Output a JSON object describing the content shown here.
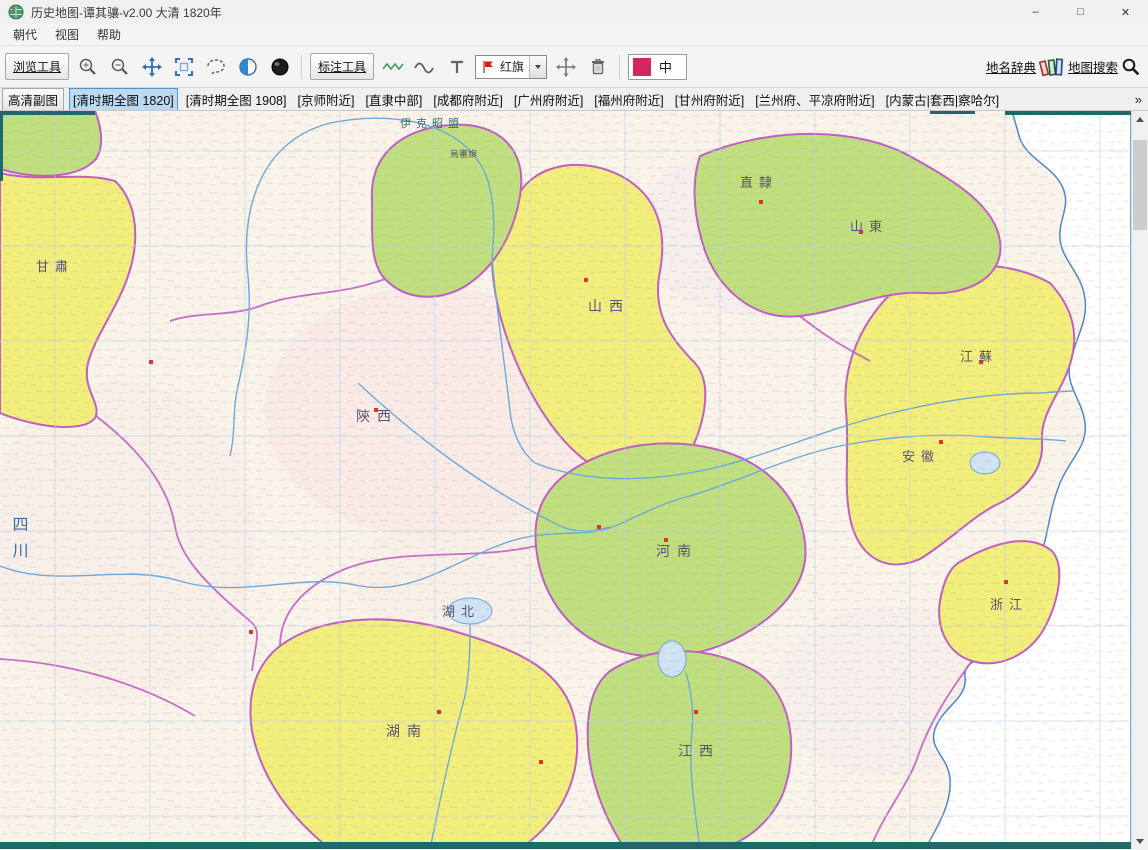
{
  "window": {
    "title": "历史地图-谭其骧-v2.00  大清 1820年",
    "controls": {
      "minimize": "–",
      "maximize": "□",
      "close": "✕"
    }
  },
  "menu": {
    "items": [
      {
        "label": "朝代"
      },
      {
        "label": "视图"
      },
      {
        "label": "帮助"
      }
    ]
  },
  "toolbar": {
    "browse_tools_label": "浏览工具",
    "annotate_tools_label": "标注工具",
    "flag_selector_value": "红旗",
    "marker_text": "中",
    "dictionary_label": "地名辞典",
    "map_search_label": "地图搜索",
    "icons": [
      "zoom-in",
      "zoom-out",
      "pan",
      "fit-view",
      "lasso-select",
      "contrast-sphere",
      "dark-sphere",
      "wave-line",
      "curve-line",
      "text-tool",
      "red-flag",
      "move",
      "trash",
      "books",
      "search"
    ],
    "marker_swatch_color": "#d42663"
  },
  "tabs": {
    "items": [
      {
        "label": "高清副图",
        "selected": false
      },
      {
        "label": "[清时期全图 1820]",
        "selected": true
      },
      {
        "label": "[清时期全图 1908]",
        "selected": false
      },
      {
        "label": "[京师附近]",
        "selected": false
      },
      {
        "label": "[直隶中部]",
        "selected": false
      },
      {
        "label": "[成都府附近]",
        "selected": false
      },
      {
        "label": "[广州府附近]",
        "selected": false
      },
      {
        "label": "[福州府附近]",
        "selected": false
      },
      {
        "label": "[甘州府附近]",
        "selected": false
      },
      {
        "label": "[兰州府、平凉府附近]",
        "selected": false
      },
      {
        "label": "[内蒙古|套西|察哈尔]",
        "selected": false
      }
    ],
    "overflow_indicator": "»"
  },
  "map": {
    "labels": [
      {
        "text": "伊克昭盟"
      },
      {
        "text": "烏審旗"
      },
      {
        "text": "山西"
      },
      {
        "text": "陝西"
      },
      {
        "text": "河南"
      },
      {
        "text": "湖北"
      },
      {
        "text": "湖南"
      },
      {
        "text": "江西"
      },
      {
        "text": "安徽"
      },
      {
        "text": "江蘇"
      },
      {
        "text": "浙江"
      },
      {
        "text": "山東"
      },
      {
        "text": "直隸"
      },
      {
        "text": "甘肅"
      },
      {
        "text": "四川"
      }
    ],
    "colors": {
      "province_yellow": "#f2ee7b",
      "province_green": "#bfdf7e",
      "boundary_purple": "#c05fc0",
      "river_blue": "#6fa8d8",
      "sea_white": "#ffffff",
      "map_edge_teal": "#1d6a68"
    }
  }
}
